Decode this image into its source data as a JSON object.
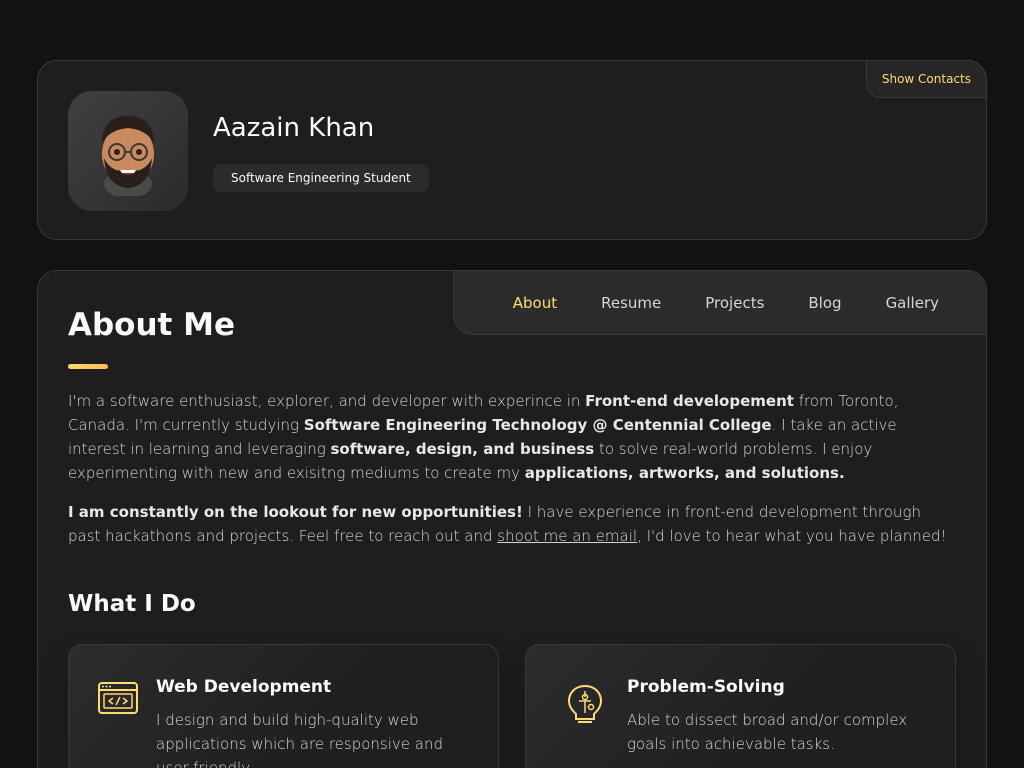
{
  "profile": {
    "name": "Aazain Khan",
    "title": "Software Engineering Student",
    "show_contacts": "Show Contacts"
  },
  "nav": {
    "items": [
      {
        "label": "About",
        "active": true
      },
      {
        "label": "Resume",
        "active": false
      },
      {
        "label": "Projects",
        "active": false
      },
      {
        "label": "Blog",
        "active": false
      },
      {
        "label": "Gallery",
        "active": false
      }
    ]
  },
  "about": {
    "heading": "About Me",
    "p1": {
      "t1": "I'm a software enthusiast, explorer, and developer with experince in ",
      "b1": "Front-end developement",
      "t2": " from Toronto, Canada. I'm currently studying ",
      "b2": "Software Engineering Technology @ Centennial College",
      "t3": ". I take an active interest in learning and leveraging ",
      "b3": "software, design, and business",
      "t4": " to solve real-world problems. I enjoy experimenting with new and exisitng mediums to create my ",
      "b4": "applications, artworks, and solutions."
    },
    "p2": {
      "b1": "I am constantly on the lookout for new opportunities!",
      "t1": " I have experience in front-end development through past hackathons and projects. Feel free to reach out and ",
      "link": "shoot me an email",
      "t2": ", I'd love to hear what you have planned!"
    }
  },
  "services": {
    "heading": "What I Do",
    "items": [
      {
        "icon": "code-window-icon",
        "title": "Web Development",
        "desc": "I design and build high-quality web applications which are responsive and user-friendly."
      },
      {
        "icon": "lightbulb-puzzle-icon",
        "title": "Problem-Solving",
        "desc": "Able to dissect broad and/or complex goals into achievable tasks."
      }
    ]
  },
  "colors": {
    "accent": "#ffdb70",
    "background": "#121212",
    "card": "#1e1e1f"
  }
}
